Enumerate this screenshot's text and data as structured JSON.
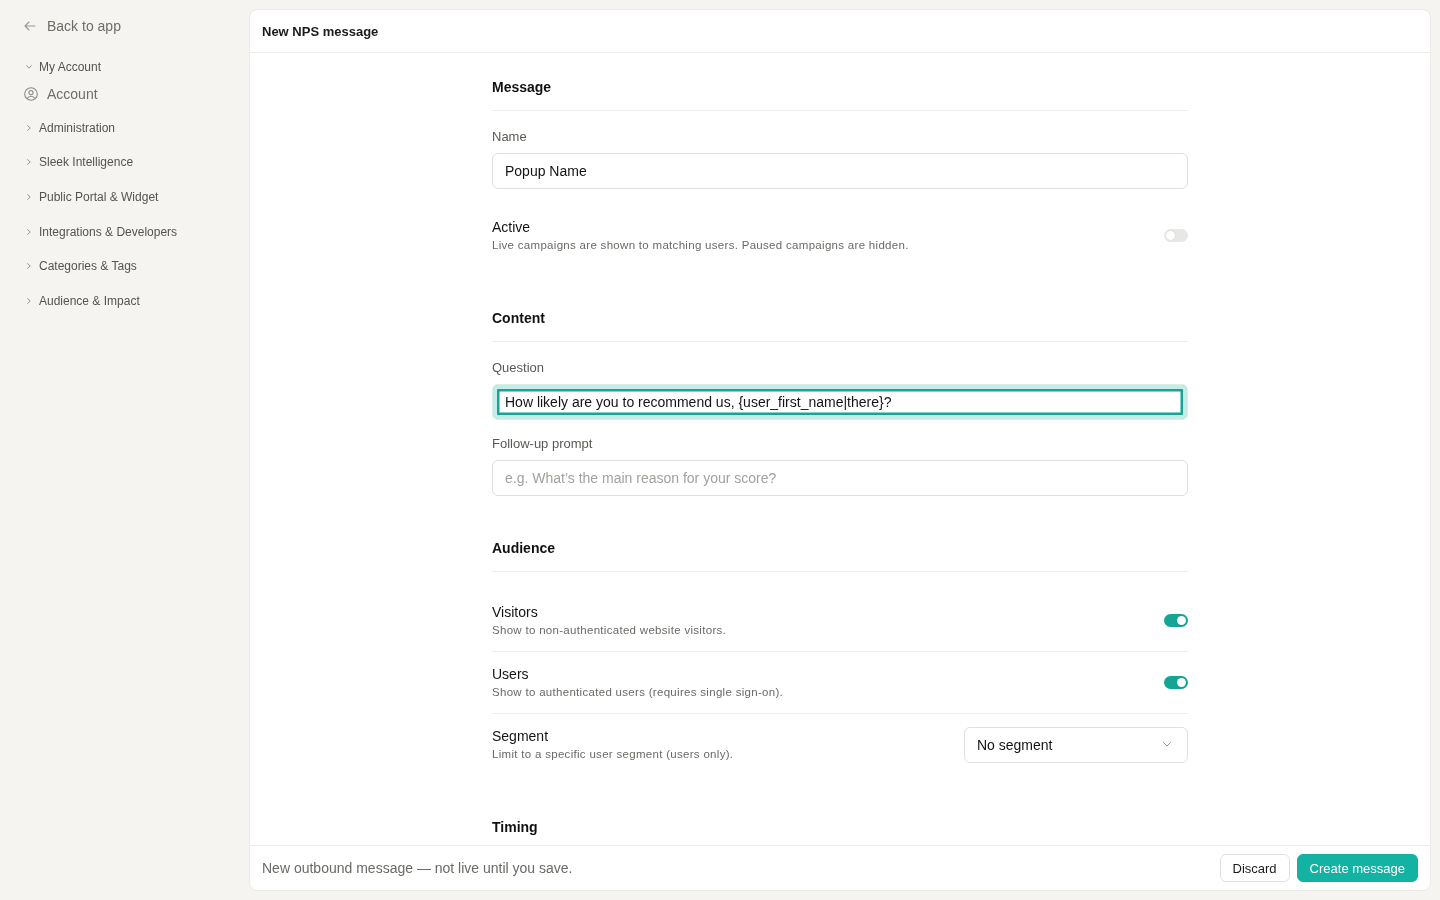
{
  "sidebar": {
    "back_link": "Back to app",
    "groups": [
      {
        "label": "My Account",
        "expanded": true,
        "children": [
          {
            "label": "Account",
            "selected": false
          }
        ]
      },
      {
        "label": "Administration",
        "expanded": false
      },
      {
        "label": "Sleek Intelligence",
        "expanded": false
      },
      {
        "label": "Public Portal & Widget",
        "expanded": false
      },
      {
        "label": "Integrations & Developers",
        "expanded": false
      },
      {
        "label": "Categories & Tags",
        "expanded": false
      },
      {
        "label": "Audience & Impact",
        "expanded": false
      }
    ]
  },
  "panel": {
    "title": "New NPS message"
  },
  "sections": [
    {
      "heading": "Message",
      "rows": [
        {
          "kind": "text_field",
          "label": "Name",
          "value": "Popup Name",
          "focused": false
        },
        {
          "kind": "toggle",
          "label": "Active",
          "description": "Live campaigns are shown to matching users. Paused campaigns are hidden.",
          "on": false
        }
      ]
    },
    {
      "heading": "Content",
      "rows": [
        {
          "kind": "text_field",
          "label": "Question",
          "value": "How likely are you to recommend us, {user_first_name|there}?",
          "focused": true
        },
        {
          "kind": "text_field",
          "label": "Follow-up prompt",
          "placeholder": "e.g. What’s the main reason for your score?",
          "focused": false
        }
      ]
    },
    {
      "heading": "Audience",
      "rows": [
        {
          "kind": "toggle",
          "label": "Visitors",
          "description": "Show to non-authenticated website visitors.",
          "on": true
        },
        {
          "kind": "toggle",
          "label": "Users",
          "description": "Show to authenticated users (requires single sign-on).",
          "on": true
        },
        {
          "kind": "select",
          "label": "Segment",
          "description": "Limit to a specific user segment (users only).",
          "value": "No segment"
        }
      ]
    },
    {
      "heading": "Timing"
    }
  ],
  "footer": {
    "note": "New outbound message — not live until you save.",
    "buttons": [
      {
        "label": "Discard",
        "kind": "secondary"
      },
      {
        "label": "Create message",
        "kind": "primary"
      }
    ]
  }
}
